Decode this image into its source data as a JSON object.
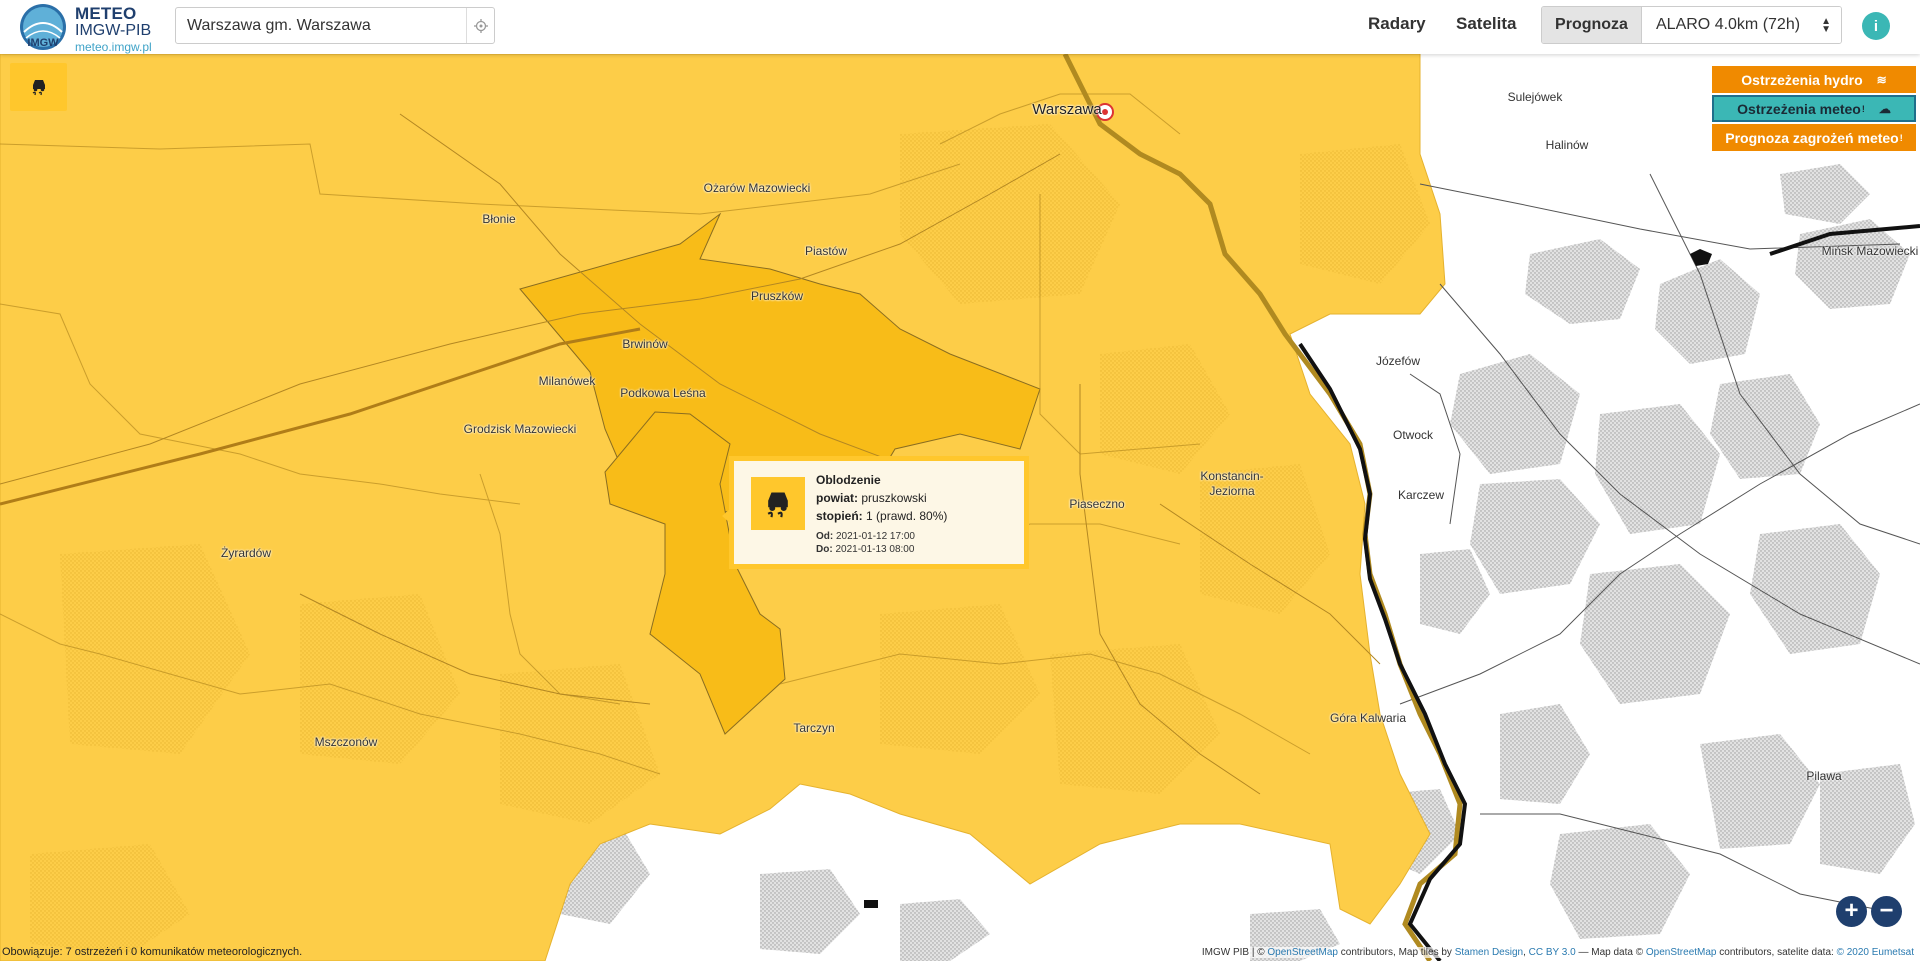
{
  "header": {
    "logo": {
      "line1": "METEO",
      "line2": "IMGW-PIB",
      "line3": "meteo.imgw.pl",
      "badge": "IMGW"
    },
    "search": {
      "value": "Warszawa gm. Warszawa"
    },
    "nav": {
      "radary": "Radary",
      "satelita": "Satelita",
      "prognoza": "Prognoza"
    },
    "model_select": {
      "value": "ALARO 4.0km (72h)"
    },
    "info_icon": "info-icon"
  },
  "layers": {
    "hydro": {
      "label": "Ostrzeżenia hydro",
      "icon": "≋"
    },
    "meteo": {
      "label": "Ostrzeżenia meteo",
      "sup": "!",
      "icon": "☁"
    },
    "zagrozenia": {
      "label": "Prognoza zagrożeń meteo",
      "sup": "!"
    }
  },
  "places": {
    "warszawa": "Warszawa",
    "sulejowek": "Sulejówek",
    "halinow": "Halinów",
    "minsk": "Mińsk Mazowiecki",
    "ozarow": "Ożarów Mazowiecki",
    "blonie": "Błonie",
    "piastow": "Piastów",
    "pruszkow": "Pruszków",
    "brwinow": "Brwinów",
    "milanowek": "Milanówek",
    "podkowa": "Podkowa Leśna",
    "grodzisk": "Grodzisk Mazowiecki",
    "jozefow": "Józefów",
    "otwock": "Otwock",
    "karczew": "Karczew",
    "konstancin1": "Konstancin-",
    "konstancin2": "Jeziorna",
    "piaseczno": "Piaseczno",
    "zyrardow": "Żyrardów",
    "tarczyn": "Tarczyn",
    "gora": "Góra Kalwaria",
    "mszczonow": "Mszczonów",
    "pilawa": "Pilawa"
  },
  "popup": {
    "title": "Oblodzenie",
    "powiat_label": "powiat:",
    "powiat_value": "pruszkowski",
    "stopien_label": "stopień:",
    "stopien_value": "1 (prawd. 80%)",
    "od_label": "Od:",
    "od_value": "2021-01-12 17:00",
    "do_label": "Do:",
    "do_value": "2021-01-13 08:00",
    "icon": "slippery-road-icon"
  },
  "zoom": {
    "in": "+",
    "out": "−"
  },
  "status": "Obowiązuje: 7 ostrzeżeń i 0 komunikatów meteorologicznych.",
  "attribution": {
    "a1": "IMGW PIB | © ",
    "l1": "OpenStreetMap",
    "a2": " contributors, Map tiles by ",
    "l2": "Stamen Design",
    "a3": ", ",
    "l3": "CC BY 3.0",
    "a4": " — Map data © ",
    "l4": "OpenStreetMap",
    "a5": " contributors, satelite data: ",
    "l5": "© 2020 Eumetsat"
  },
  "colors": {
    "warning_yellow": "#ffc72c",
    "warning_fill": "#fdcd48",
    "highlight_fill": "#f7b800",
    "orange": "#f08a00",
    "teal": "#3bb7b5",
    "navy": "#1f3f6e"
  }
}
